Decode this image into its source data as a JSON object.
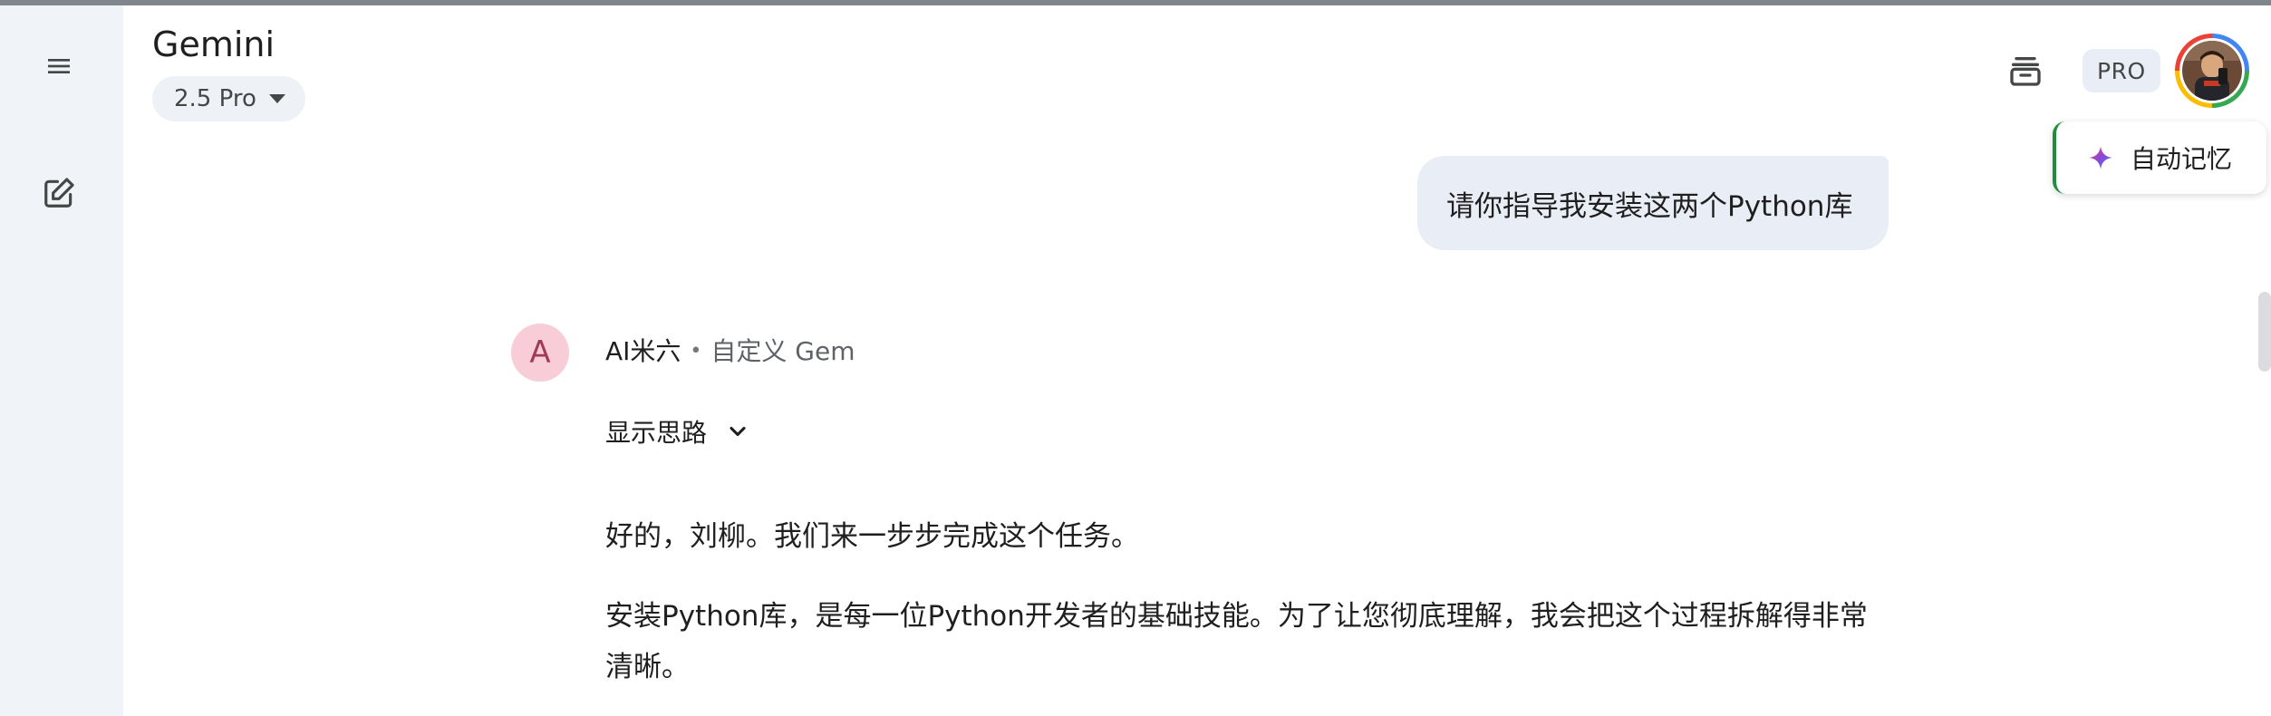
{
  "app": {
    "title": "Gemini",
    "model_selector_label": "2.5 Pro",
    "pro_badge": "PRO"
  },
  "sidebar": {
    "menu_icon": "menu-icon",
    "new_chat_icon": "edit-icon"
  },
  "header": {
    "library_icon": "stack-icon",
    "avatar_icon": "profile-photo"
  },
  "memory_chip": {
    "label": "自动记忆",
    "icon": "sparkle-gem-icon"
  },
  "conversation": {
    "user_message": "请你指导我安装这两个Python库",
    "assistant": {
      "avatar_letter": "A",
      "name": "AI米六",
      "separator": "•",
      "gem_label": "自定义 Gem",
      "thoughts_toggle": "显示思路",
      "paragraphs": [
        "好的，刘柳。我们来一步步完成这个任务。",
        "安装Python库，是每一位Python开发者的基础技能。为了让您彻底理解，我会把这个过程拆解得非常清晰。"
      ]
    }
  },
  "colors": {
    "sidebar_bg": "#f0f4f9",
    "bubble_bg": "#e9eef6",
    "gem_avatar_bg": "#f8cdd8",
    "accent_green": "#1e8e3e"
  }
}
